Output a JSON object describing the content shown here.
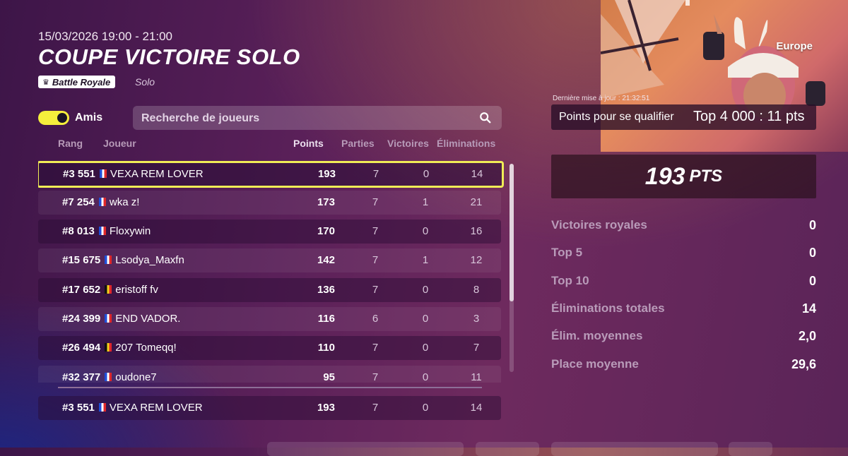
{
  "header": {
    "date_range": "15/03/2026 19:00 - 21:00",
    "title": "COUPE VICTOIRE SOLO",
    "mode_badge": "Battle Royale",
    "mode_sub": "Solo"
  },
  "filters": {
    "friends_toggle_label": "Amis",
    "friends_toggle_on": true,
    "search_placeholder": "Recherche de joueurs"
  },
  "table": {
    "columns": {
      "rank": "Rang",
      "player": "Joueur",
      "points": "Points",
      "matches": "Parties",
      "wins": "Victoires",
      "eliminations": "Éliminations"
    },
    "rows": [
      {
        "rank": "#3 551",
        "flag": "fr",
        "player": "VEXA REM LOVER",
        "points": "193",
        "matches": "7",
        "wins": "0",
        "elims": "14"
      },
      {
        "rank": "#7 254",
        "flag": "fr",
        "player": "wka z!",
        "points": "173",
        "matches": "7",
        "wins": "1",
        "elims": "21"
      },
      {
        "rank": "#8 013",
        "flag": "fr",
        "player": "Floxywin",
        "points": "170",
        "matches": "7",
        "wins": "0",
        "elims": "16"
      },
      {
        "rank": "#15 675",
        "flag": "fr",
        "player": "Lsodya_Maxfn",
        "points": "142",
        "matches": "7",
        "wins": "1",
        "elims": "12"
      },
      {
        "rank": "#17 652",
        "flag": "be",
        "player": "eristoff fv",
        "points": "136",
        "matches": "7",
        "wins": "0",
        "elims": "8"
      },
      {
        "rank": "#24 399",
        "flag": "fr",
        "player": "END VADOR.",
        "points": "116",
        "matches": "6",
        "wins": "0",
        "elims": "3"
      },
      {
        "rank": "#26 494",
        "flag": "be",
        "player": "207 Tomeqq!",
        "points": "110",
        "matches": "7",
        "wins": "0",
        "elims": "7"
      },
      {
        "rank": "#32 377",
        "flag": "fr",
        "player": "oudone7",
        "points": "95",
        "matches": "7",
        "wins": "0",
        "elims": "11"
      }
    ],
    "self_row": {
      "rank": "#3 551",
      "flag": "fr",
      "player": "VEXA REM LOVER",
      "points": "193",
      "matches": "7",
      "wins": "0",
      "elims": "14"
    }
  },
  "sidebar": {
    "region": "Europe",
    "last_update": "Dernière mise à jour : 21:32:51",
    "qualify_label": "Points pour se qualifier",
    "qualify_value": "Top 4 000 : 11 pts",
    "total_points": "193",
    "total_unit": "PTS",
    "stats": [
      {
        "label": "Victoires royales",
        "value": "0"
      },
      {
        "label": "Top 5",
        "value": "0"
      },
      {
        "label": "Top 10",
        "value": "0"
      },
      {
        "label": "Éliminations totales",
        "value": "14"
      },
      {
        "label": "Élim. moyennes",
        "value": "2,0"
      },
      {
        "label": "Place moyenne",
        "value": "29,6"
      }
    ]
  },
  "colors": {
    "accent_yellow": "#f0ec56",
    "background": "#5a2059"
  },
  "icons": [
    "crown-icon",
    "search-icon",
    "flag-fr-icon",
    "flag-be-icon"
  ]
}
